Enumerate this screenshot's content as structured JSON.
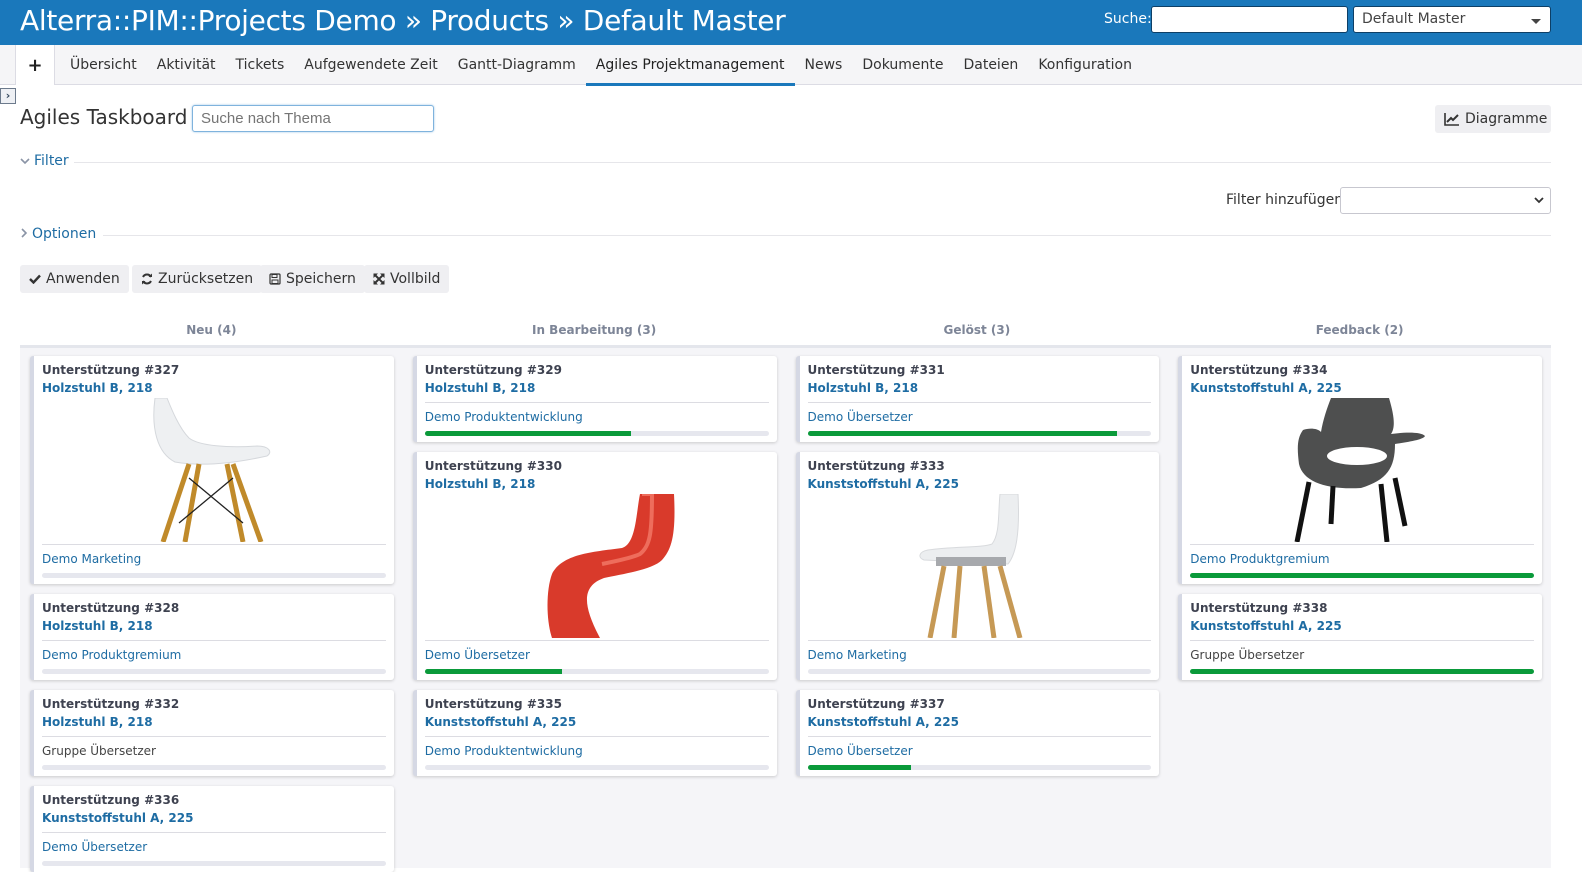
{
  "header": {
    "title": "Alterra::PIM::Projects Demo » Products » Default Master",
    "search_label": "Suche:",
    "search_value": "",
    "project_select": "Default Master"
  },
  "main_menu": {
    "new_object": "+",
    "tabs": [
      {
        "label": "Übersicht",
        "selected": false
      },
      {
        "label": "Aktivität",
        "selected": false
      },
      {
        "label": "Tickets",
        "selected": false
      },
      {
        "label": "Aufgewendete Zeit",
        "selected": false
      },
      {
        "label": "Gantt-Diagramm",
        "selected": false
      },
      {
        "label": "Agiles Projektmanagement",
        "selected": true
      },
      {
        "label": "News",
        "selected": false
      },
      {
        "label": "Dokumente",
        "selected": false
      },
      {
        "label": "Dateien",
        "selected": false
      },
      {
        "label": "Konfiguration",
        "selected": false
      }
    ]
  },
  "page": {
    "title": "Agiles Taskboard",
    "subject_search_placeholder": "Suche nach Thema",
    "charts_button": "Diagramme",
    "filter_legend": "Filter",
    "add_filter_label": "Filter hinzufügen",
    "add_filter_value": "",
    "options_legend": "Optionen"
  },
  "buttons": {
    "apply": "Anwenden",
    "reset": "Zurücksetzen",
    "save": "Speichern",
    "fullscreen": "Vollbild"
  },
  "colors": {
    "header": "#1a78bb",
    "link": "#1e6ca3",
    "progress": "#0a9a3a"
  },
  "board": {
    "columns": [
      {
        "title": "Neu (4)",
        "cards": [
          {
            "tracker": "Unterstützung #327",
            "subject": "Holzstuhl B, 218",
            "image": "white-eames-chair",
            "assignee": "Demo Marketing",
            "assignee_group": false,
            "done_ratio": 0
          },
          {
            "tracker": "Unterstützung #328",
            "subject": "Holzstuhl B, 218",
            "image": null,
            "assignee": "Demo Produktgremium",
            "assignee_group": false,
            "done_ratio": 0
          },
          {
            "tracker": "Unterstützung #332",
            "subject": "Holzstuhl B, 218",
            "image": null,
            "assignee": "Gruppe Übersetzer",
            "assignee_group": true,
            "done_ratio": 0
          },
          {
            "tracker": "Unterstützung #336",
            "subject": "Kunststoffstuhl A, 225",
            "image": null,
            "assignee": "Demo Übersetzer",
            "assignee_group": false,
            "done_ratio": 0
          }
        ]
      },
      {
        "title": "In Bearbeitung (3)",
        "cards": [
          {
            "tracker": "Unterstützung #329",
            "subject": "Holzstuhl B, 218",
            "image": null,
            "assignee": "Demo Produktentwicklung",
            "assignee_group": false,
            "done_ratio": 60
          },
          {
            "tracker": "Unterstützung #330",
            "subject": "Holzstuhl B, 218",
            "image": "red-panton-chair",
            "assignee": "Demo Übersetzer",
            "assignee_group": false,
            "done_ratio": 40
          },
          {
            "tracker": "Unterstützung #335",
            "subject": "Kunststoffstuhl A, 225",
            "image": null,
            "assignee": "Demo Produktentwicklung",
            "assignee_group": false,
            "done_ratio": 0
          }
        ]
      },
      {
        "title": "Gelöst (3)",
        "cards": [
          {
            "tracker": "Unterstützung #331",
            "subject": "Holzstuhl B, 218",
            "image": null,
            "assignee": "Demo Übersetzer",
            "assignee_group": false,
            "done_ratio": 90
          },
          {
            "tracker": "Unterstützung #333",
            "subject": "Kunststoffstuhl A, 225",
            "image": "white-wooden-leg-chair",
            "assignee": "Demo Marketing",
            "assignee_group": false,
            "done_ratio": 0
          },
          {
            "tracker": "Unterstützung #337",
            "subject": "Kunststoffstuhl A, 225",
            "image": null,
            "assignee": "Demo Übersetzer",
            "assignee_group": false,
            "done_ratio": 30
          }
        ]
      },
      {
        "title": "Feedback (2)",
        "cards": [
          {
            "tracker": "Unterstützung #334",
            "subject": "Kunststoffstuhl A, 225",
            "image": "grey-armchair",
            "assignee": "Demo Produktgremium",
            "assignee_group": false,
            "done_ratio": 100
          },
          {
            "tracker": "Unterstützung #338",
            "subject": "Kunststoffstuhl A, 225",
            "image": null,
            "assignee": "Gruppe Übersetzer",
            "assignee_group": true,
            "done_ratio": 100
          }
        ]
      }
    ]
  }
}
